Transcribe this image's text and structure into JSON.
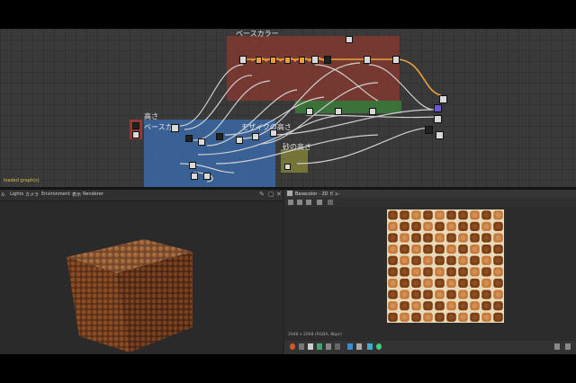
{
  "graph": {
    "frames": [
      {
        "title": "ベースカラー",
        "color": "#8a3a2f"
      },
      {
        "title": "高さ",
        "color": "#a83a3a"
      },
      {
        "title": "ベースカ",
        "color": "#3a6fb4"
      },
      {
        "title": "モザイクの高さ",
        "color": "#3a6fb4"
      },
      {
        "title": "砂の高さ",
        "color": "#8a8a3a"
      },
      {
        "title": "",
        "color": "#3a8a3a"
      }
    ],
    "status_log": "loaded graph(s)"
  },
  "view3d": {
    "menu": [
      "ル",
      "Lights",
      "カメラ",
      "Environment",
      "表示",
      "Renderer"
    ]
  },
  "view2d": {
    "tab_label": "Basecolor - 2D ビュ-",
    "texture_info": "2048 x 2048 (RGBA, 8bpc)"
  },
  "colors": {
    "accent": "#e8a33a",
    "tile_dark": "#7a3f14",
    "tile_light": "#c77a3a",
    "grout": "#e8d9b8"
  }
}
